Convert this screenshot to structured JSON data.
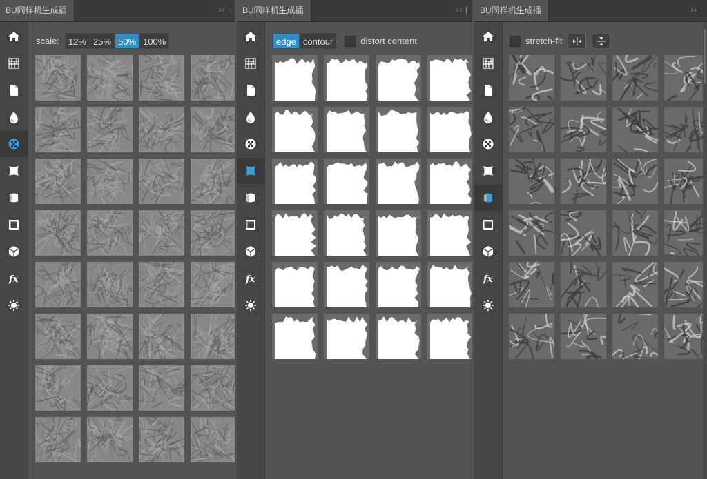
{
  "panels": [
    {
      "tab_title": "BU同样机生成插件",
      "tab_controls": "››  |",
      "active_sidebar": 4,
      "scale": {
        "label": "scale:",
        "options": [
          "12%",
          "25%",
          "50%",
          "100%"
        ],
        "selected": "50%"
      }
    },
    {
      "tab_title": "BU同样机生成插件",
      "tab_controls": "››  |",
      "active_sidebar": 5,
      "mode": {
        "options": [
          "edge",
          "contour"
        ],
        "selected": "edge"
      },
      "distort_label": "distort content",
      "distort_checked": false
    },
    {
      "tab_title": "BU同样机生成插件",
      "tab_controls": "››  |",
      "active_sidebar": 6,
      "stretch_label": "stretch-fit",
      "stretch_checked": false,
      "buttons": [
        "flip-horizontal-icon",
        "align-vertical-center-icon"
      ]
    }
  ],
  "sidebar_icons": [
    "home-icon",
    "grid-pattern-icon",
    "document-icon",
    "water-drop-icon",
    "checkerboard-icon",
    "distort-square-icon",
    "fabric-roll-icon",
    "frame-icon",
    "cube-icon",
    "fx-icon",
    "sun-icon"
  ],
  "colors": {
    "accent": "#2d8fc7",
    "panel_bg": "#535353",
    "sidebar_bg": "#454545",
    "tab_bg": "#3a3a3a"
  }
}
